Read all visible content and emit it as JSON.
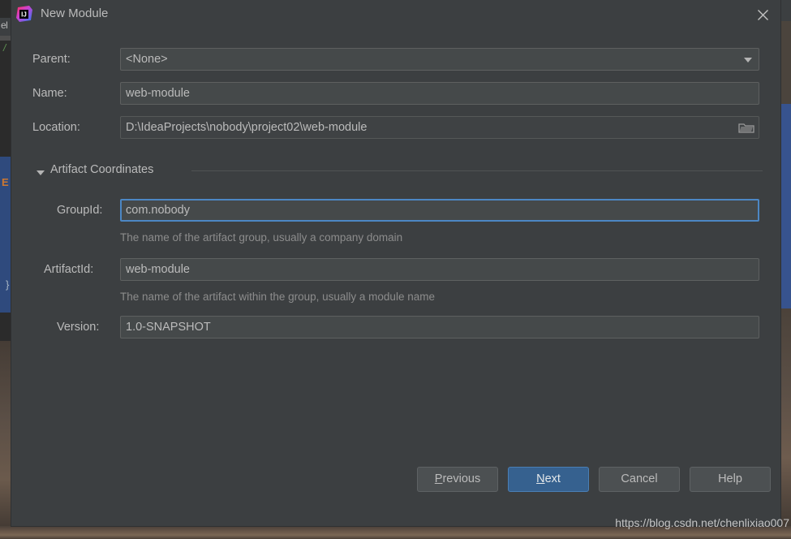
{
  "window": {
    "title": "New Module",
    "app_icon": "intellij-idea-icon",
    "close_icon": "close-icon"
  },
  "form": {
    "parent": {
      "label": "Parent:",
      "value": "<None>",
      "dropdown_icon": "chevron-down-icon"
    },
    "name": {
      "label": "Name:",
      "value": "web-module"
    },
    "location": {
      "label": "Location:",
      "value": "D:\\IdeaProjects\\nobody\\project02\\web-module",
      "browse_icon": "folder-icon"
    }
  },
  "artifact_section": {
    "title": "Artifact Coordinates",
    "collapse_icon": "triangle-down-icon",
    "group_id": {
      "label": "GroupId:",
      "value": "com.nobody",
      "hint": "The name of the artifact group, usually a company domain"
    },
    "artifact_id": {
      "label": "ArtifactId:",
      "value": "web-module",
      "hint": "The name of the artifact within the group, usually a module name"
    },
    "version": {
      "label": "Version:",
      "value": "1.0-SNAPSHOT"
    }
  },
  "buttons": {
    "previous": {
      "prefix": "",
      "mnemonic": "P",
      "suffix": "revious"
    },
    "next": {
      "prefix": "",
      "mnemonic": "N",
      "suffix": "ext"
    },
    "cancel": {
      "label": "Cancel"
    },
    "help": {
      "label": "Help"
    }
  },
  "watermark": "https://blog.csdn.net/chenlixiao007",
  "background": {
    "editor_tab_text": "el",
    "editor_keyword": "E",
    "editor_brace": "}",
    "editor_comment": "/"
  },
  "colors": {
    "dialog_bg": "#3c3f41",
    "field_bg": "#45494a",
    "focus_border": "#4c87c4",
    "primary_button": "#36618f",
    "text": "#bbbbbb",
    "hint_text": "#8c8c8c"
  }
}
